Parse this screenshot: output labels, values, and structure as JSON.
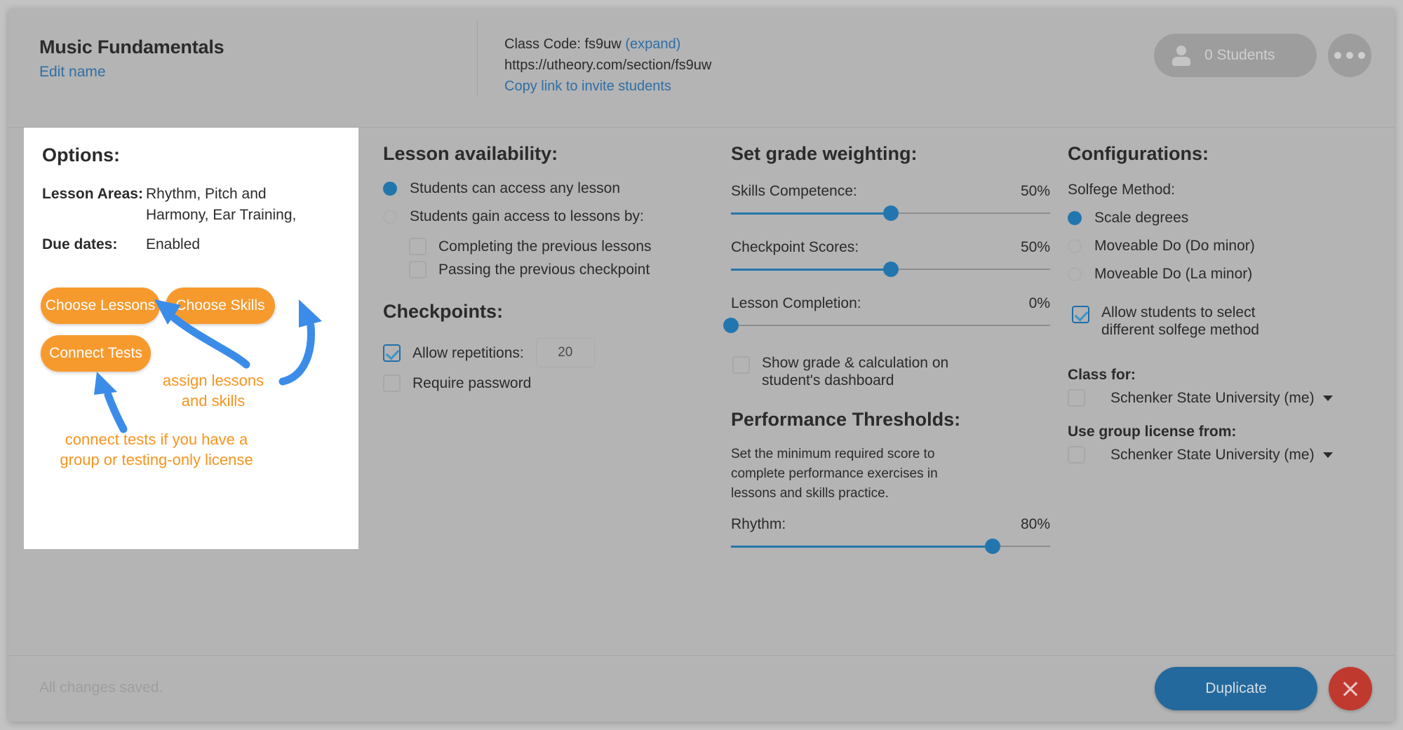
{
  "header": {
    "title": "Music Fundamentals",
    "edit_name": "Edit name",
    "class_code_label": "Class Code: fs9uw",
    "class_code_expand": "(expand)",
    "class_url": "https://utheory.com/section/fs9uw",
    "copy_link": "Copy link to invite students",
    "students_count_label": "0 Students",
    "person_icon": "person-icon",
    "more_icon": "ellipsis-icon"
  },
  "options": {
    "title": "Options:",
    "rows": [
      {
        "key": "Lesson Areas:",
        "value": "Rhythm, Pitch and Harmony, Ear Training,"
      },
      {
        "key": "Due dates:",
        "value": "Enabled"
      }
    ],
    "buttons": {
      "choose_lessons": "Choose Lessons",
      "choose_skills": "Choose Skills",
      "connect_tests": "Connect Tests"
    },
    "annotations": {
      "assign": "assign lessons\nand skills",
      "assign_line1": "assign lessons",
      "assign_line2": "and skills",
      "connect_line1": "connect tests if you have a",
      "connect_line2": "group or testing-only license"
    }
  },
  "availability": {
    "title": "Lesson availability:",
    "radios": [
      {
        "label": "Students can access any lesson",
        "selected": true
      },
      {
        "label": "Students gain access to lessons by:",
        "selected": false
      }
    ],
    "sub_checkboxes": [
      {
        "label": "Completing the previous lessons",
        "checked": false
      },
      {
        "label": "Passing the previous checkpoint",
        "checked": false
      }
    ]
  },
  "checkpoints": {
    "title": "Checkpoints:",
    "allow_repetitions_label": "Allow repetitions:",
    "allow_repetitions_checked": true,
    "repetitions_value": "20",
    "require_password_label": "Require password",
    "require_password_checked": false
  },
  "grading": {
    "title": "Set grade weighting:",
    "sliders": [
      {
        "label": "Skills Competence:",
        "value": 50,
        "display": "50%"
      },
      {
        "label": "Checkpoint Scores:",
        "value": 50,
        "display": "50%"
      },
      {
        "label": "Lesson Completion:",
        "value": 0,
        "display": "0%"
      }
    ],
    "show_grade_label": "Show grade & calculation on student's dashboard",
    "show_grade_checked": false
  },
  "thresholds": {
    "title": "Performance Thresholds:",
    "description": "Set the minimum required score to complete performance exercises in lessons and skills practice.",
    "sliders": [
      {
        "label": "Rhythm:",
        "value": 80,
        "display": "80%"
      }
    ]
  },
  "configurations": {
    "title": "Configurations:",
    "solfege_label": "Solfege Method:",
    "solfege_options": [
      {
        "label": "Scale degrees",
        "selected": true
      },
      {
        "label": "Moveable Do (Do minor)",
        "selected": false
      },
      {
        "label": "Moveable Do (La minor)",
        "selected": false
      }
    ],
    "allow_select_label": "Allow students to select different solfege method",
    "allow_select_checked": true,
    "class_for_label": "Class for:",
    "class_for_value": "Schenker State University (me)",
    "class_for_checked": false,
    "group_license_label": "Use group license from:",
    "group_license_value": "Schenker State University (me)",
    "group_license_checked": false
  },
  "footer": {
    "status": "All changes saved.",
    "duplicate": "Duplicate",
    "close_icon": "close-x-icon"
  },
  "colors": {
    "accent_blue": "#2376ad",
    "orange": "#f7941d",
    "danger_red": "#c0392f",
    "link_blue": "#2f6ea5",
    "overlay_gray": "#b4b4b4"
  }
}
